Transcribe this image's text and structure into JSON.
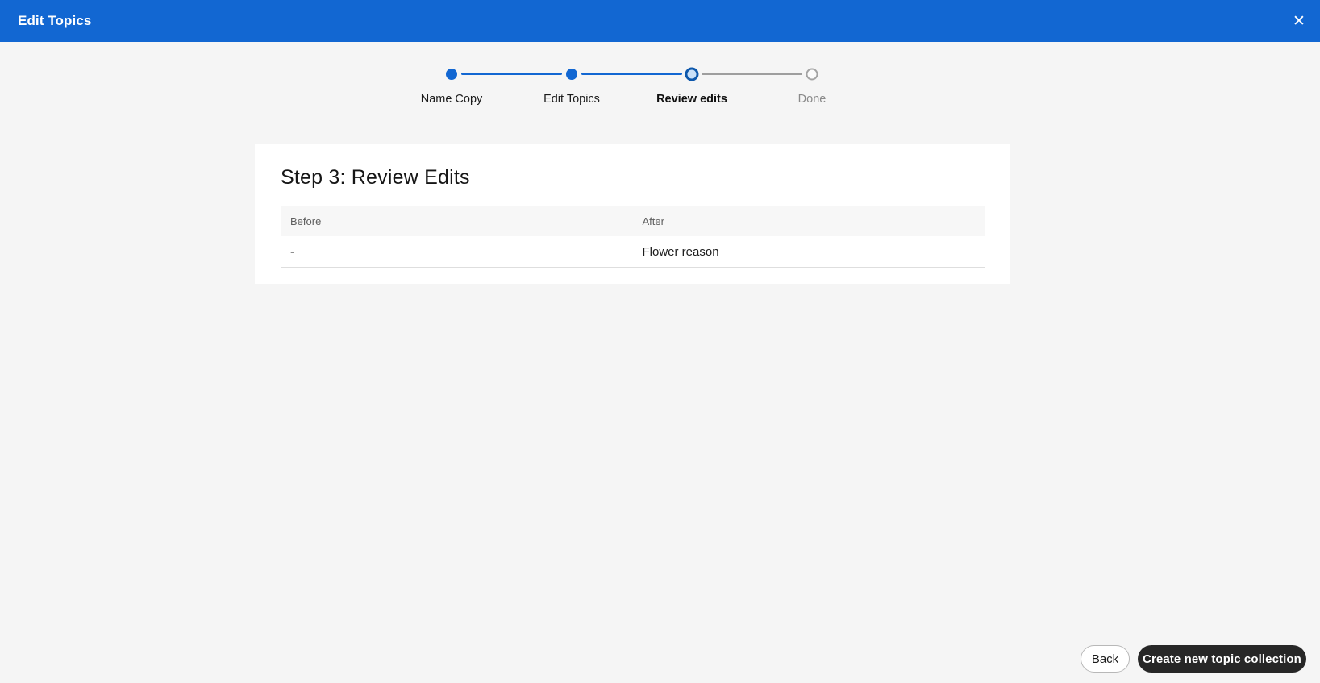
{
  "header": {
    "title": "Edit Topics",
    "close_glyph": "✕",
    "background_color": "#1267d2"
  },
  "stepper": {
    "steps": [
      {
        "label": "Name Copy",
        "state": "completed"
      },
      {
        "label": "Edit Topics",
        "state": "completed"
      },
      {
        "label": "Review edits",
        "state": "active"
      },
      {
        "label": "Done",
        "state": "upcoming"
      }
    ]
  },
  "card": {
    "title": "Step 3: Review Edits",
    "table": {
      "columns": [
        "Before",
        "After"
      ],
      "rows": [
        {
          "before": "-",
          "after": "Flower reason"
        }
      ]
    }
  },
  "footer": {
    "back_label": "Back",
    "create_label": "Create new topic collection"
  },
  "colors": {
    "accent_blue": "#1267d2",
    "active_dot_fill": "#c9e0f8",
    "active_dot_border": "#0e58ac",
    "upcoming_gray": "#a3a3a3",
    "dark_button": "#272727",
    "page_background": "#f5f5f5"
  }
}
